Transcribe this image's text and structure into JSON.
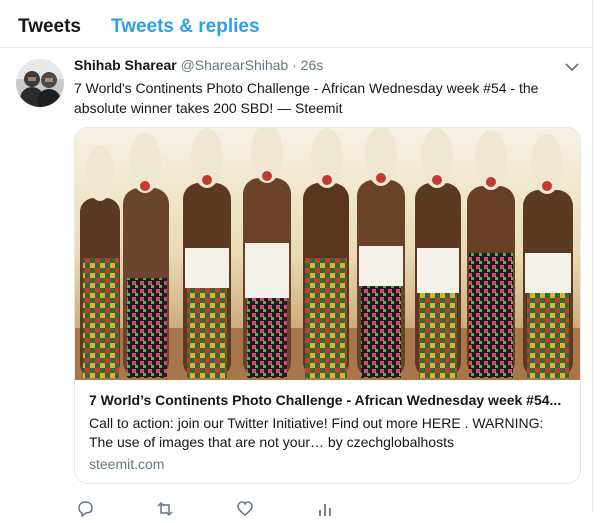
{
  "tabs": {
    "tweets": "Tweets",
    "replies": "Tweets & replies"
  },
  "tweet": {
    "author_name": "Shihab Sharear",
    "author_handle": "@SharearShihab",
    "separator": "·",
    "time": "26s",
    "text": "7 World's Continents Photo Challenge - African Wednesday week #54 - the absolute winner takes 200 SBD! — Steemit"
  },
  "card": {
    "image_icon": "dancers-photo",
    "title": "7 World’s Continents Photo Challenge - African Wednesday week #54...",
    "description": "Call to action: join our Twitter Initiative! Find out more HERE . WARNING: The use of images that are not your… by czechglobalhosts",
    "domain": "steemit.com"
  },
  "actions": {
    "icons": [
      "reply-icon",
      "retweet-icon",
      "like-icon",
      "analytics-icon"
    ]
  },
  "colors": {
    "accent": "#2aa1e8",
    "text": "#14171a",
    "secondary": "#657786",
    "border": "#e1e8ed"
  }
}
